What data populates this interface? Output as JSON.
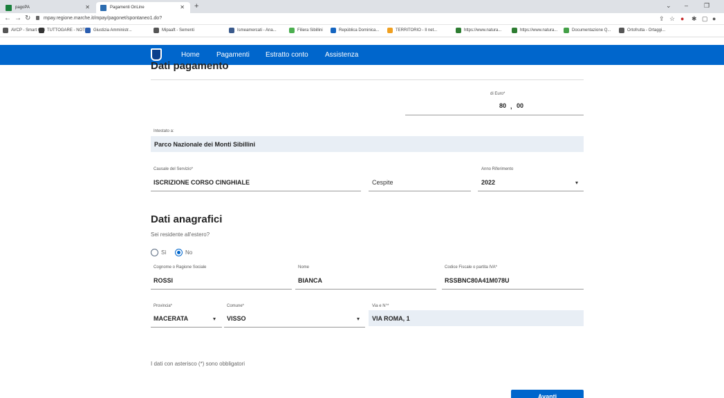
{
  "browser": {
    "tabs": [
      {
        "label": "pagoPA",
        "favicon_color": "#1a7f3c"
      },
      {
        "label": "Pagamenti OnLine",
        "favicon_color": "#2b6cb0"
      }
    ],
    "new_tab": "+",
    "url": "mpay.regione.marche.it/mpay/pagonet/spontaneo1.do?",
    "bookmarks": [
      {
        "label": "AVCP - Smart CIG",
        "color": "#555"
      },
      {
        "label": "TUTTOGARE - NOTI...",
        "color": "#333"
      },
      {
        "label": "Giustizia Amministr...",
        "color": "#2a5db0"
      },
      {
        "label": "Mipaaft - Sementi",
        "color": "#555"
      },
      {
        "label": "Ismeamercati - Ana...",
        "color": "#3a5a8c"
      },
      {
        "label": "Filiera Sibillini",
        "color": "#4caf50"
      },
      {
        "label": "República Dominica...",
        "color": "#1565c0"
      },
      {
        "label": "TERRITORIO - Il net...",
        "color": "#f0a020"
      },
      {
        "label": "https://www.natura...",
        "color": "#2e7d32"
      },
      {
        "label": "https://www.natura...",
        "color": "#2e7d32"
      },
      {
        "label": "Documentazione Q...",
        "color": "#43a047"
      },
      {
        "label": "Ortofrutta - Ortaggi...",
        "color": "#555"
      }
    ]
  },
  "nav": {
    "items": [
      "Home",
      "Pagamenti",
      "Estratto conto",
      "Assistenza"
    ]
  },
  "payment": {
    "section_title": "Dati pagamento",
    "amount_label": "di Euro*",
    "amount_int": "80",
    "amount_sep": ",",
    "amount_dec": "00",
    "holder_label": "Intestato a:",
    "holder_value": "Parco Nazionale dei Monti Sibillini",
    "causale_label": "Causale del Servizio*",
    "causale_value": "ISCRIZIONE CORSO CINGHIALE",
    "cespite_placeholder": "Cespite",
    "anno_label": "Anno Riferimento",
    "anno_value": "2022"
  },
  "personal": {
    "section_title": "Dati anagrafici",
    "resident_question": "Sei residente all'estero?",
    "radio_si": "Sì",
    "radio_no": "No",
    "cognome_label": "Cognome o Ragione Sociale",
    "cognome_value": "ROSSI",
    "nome_label": "Nome",
    "nome_value": "BIANCA",
    "cf_label": "Codice Fiscale o partita IVA*",
    "cf_value": "RSSBNC80A41M078U",
    "provincia_label": "Provincia*",
    "provincia_value": "MACERATA",
    "comune_label": "Comune*",
    "comune_value": "VISSO",
    "via_label": "Via e N°*",
    "via_value": "VIA ROMA, 1"
  },
  "footer": {
    "required_note": "I dati con asterisco (*) sono obbligatori",
    "next_button": "Avanti"
  }
}
